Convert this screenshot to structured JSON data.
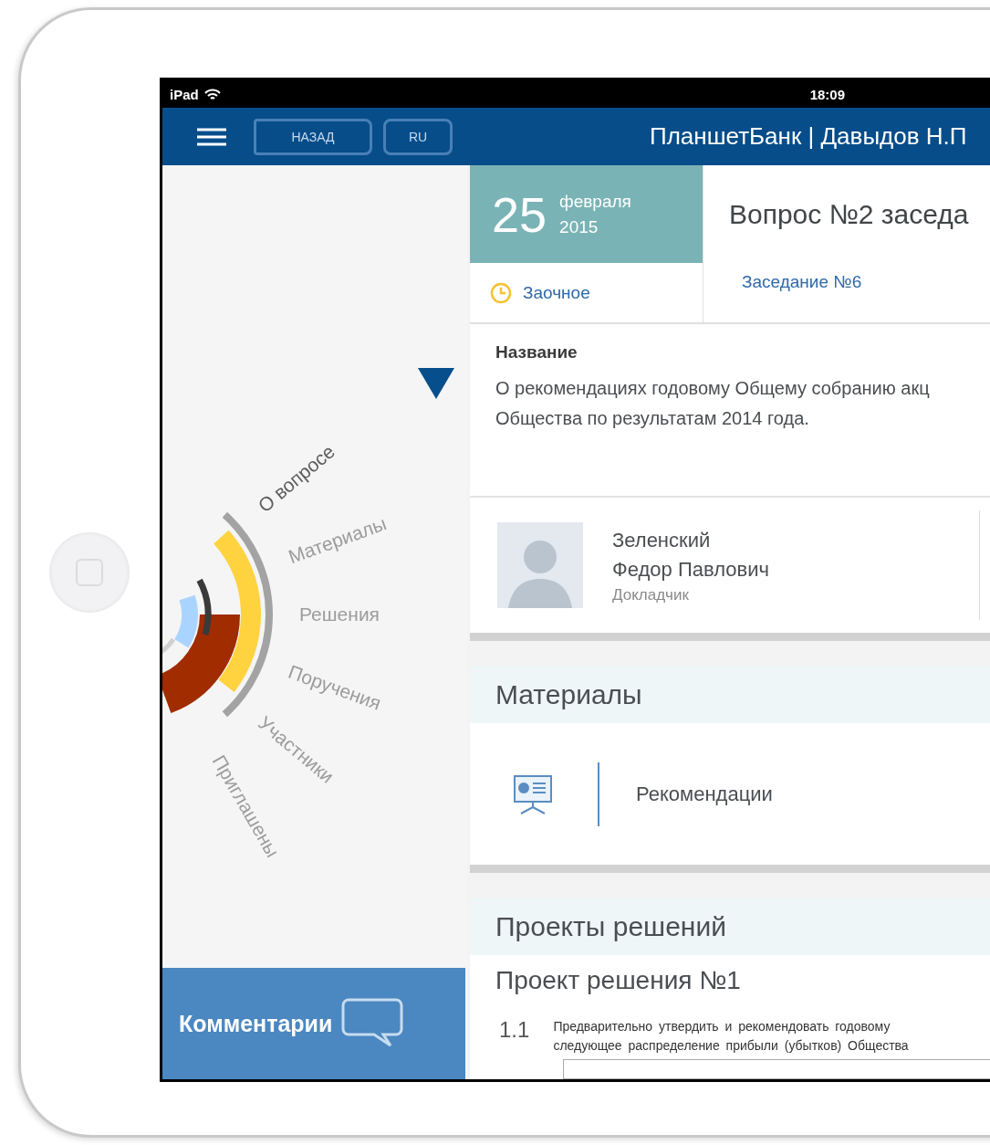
{
  "status_bar": {
    "device": "iPad",
    "time": "18:09"
  },
  "nav_bar": {
    "back_button": "НАЗАД",
    "language_button": "RU",
    "title": "ПланшетБанк | Давыдов Н.П"
  },
  "radial_menu": [
    {
      "label": "О вопросе",
      "selected": true
    },
    {
      "label": "Материалы",
      "selected": false
    },
    {
      "label": "Решения",
      "selected": false
    },
    {
      "label": "Поручения",
      "selected": false
    },
    {
      "label": "Участники",
      "selected": false
    },
    {
      "label": "Приглашены",
      "selected": false
    }
  ],
  "comments_button": "Комментарии",
  "date": {
    "day": "25",
    "month": "февраля",
    "year": "2015"
  },
  "meeting_type": "Заочное",
  "question_title": "Вопрос №2 заседа",
  "meeting_link": "Заседание №6",
  "name_section": {
    "label": "Название",
    "text": "О рекомендациях годовому Общему собранию акц\nОбщества по результатам 2014 года."
  },
  "speaker": {
    "surname": "Зеленский",
    "name": "Федор Павлович",
    "role": "Докладчик"
  },
  "materials": {
    "heading": "Материалы",
    "items": [
      {
        "title": "Рекомендации"
      }
    ]
  },
  "decisions": {
    "heading": "Проекты решений",
    "project_title": "Проект решения №1",
    "items": [
      {
        "number": "1.1",
        "text": "Предварительно утвердить и рекомендовать годовому\nследующее распределение прибыли (убытков) Общества"
      }
    ]
  }
}
